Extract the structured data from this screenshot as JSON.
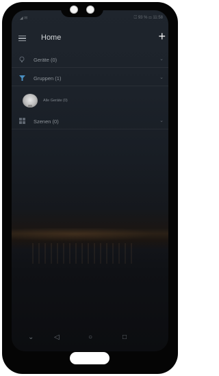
{
  "status": {
    "left": "◢ ✉",
    "right": "⏍ 93 % ▭ 11:58"
  },
  "header": {
    "title": "Home",
    "menu_icon": "menu-icon",
    "add_icon": "plus-icon"
  },
  "sections": [
    {
      "label": "Geräte (0)",
      "icon": "lightbulb-icon",
      "expand": "chevron-down-icon"
    },
    {
      "label": "Gruppen (1)",
      "icon": "filter-icon",
      "expand": "chevron-down-icon"
    },
    {
      "label": "Szenen (0)",
      "icon": "scenes-icon",
      "expand": "chevron-down-icon"
    }
  ],
  "group_item": {
    "label": "Alle Geräte (0)",
    "icon": "bulb-image"
  },
  "nav": {
    "back": "◁",
    "home": "○",
    "recents": "□",
    "down": "⌄"
  },
  "colors": {
    "background_dark": "#1c222a",
    "text_primary": "#d4d7da",
    "text_secondary": "#8f959b"
  }
}
